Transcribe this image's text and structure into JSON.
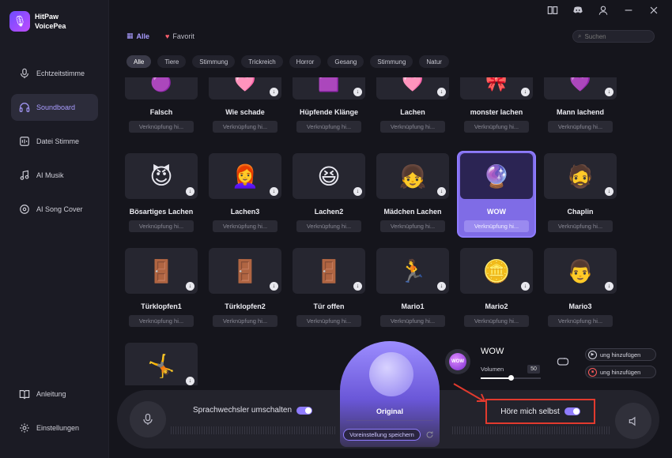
{
  "app": {
    "name_line1": "HitPaw",
    "name_line2": "VoicePea"
  },
  "sidebar": {
    "items": [
      {
        "label": "Echtzeitstimme",
        "icon": "microphone-icon"
      },
      {
        "label": "Soundboard",
        "icon": "headphones-icon",
        "active": true
      },
      {
        "label": "Datei Stimme",
        "icon": "file-voice-icon"
      },
      {
        "label": "AI Musik",
        "icon": "music-note-icon"
      },
      {
        "label": "AI Song Cover",
        "icon": "disc-icon"
      }
    ],
    "bottom": [
      {
        "label": "Anleitung",
        "icon": "book-icon"
      },
      {
        "label": "Einstellungen",
        "icon": "gear-icon"
      }
    ]
  },
  "tabs": [
    {
      "label": "Alle",
      "icon": "grid-icon",
      "active": true
    },
    {
      "label": "Favorit",
      "icon": "heart-icon"
    }
  ],
  "search": {
    "placeholder": "Suchen"
  },
  "filters": [
    "Alle",
    "Tiere",
    "Stimmung",
    "Trickreich",
    "Horror",
    "Gesang",
    "Stimmung",
    "Natur"
  ],
  "shortcut_label": "Verknüpfung hi...",
  "sounds_row1": [
    "Falsch",
    "Wie schade",
    "Hüpfende Klänge",
    "Lachen",
    "monster lachen",
    "Mann lachend"
  ],
  "sounds_row2": [
    "Bösartiges Lachen",
    "Lachen3",
    "Lachen2",
    "Mädchen Lachen",
    "WOW",
    "Chaplin"
  ],
  "sounds_row3": [
    "Türklopfen1",
    "Türklopfen2",
    "Tür offen",
    "Mario1",
    "Mario2",
    "Mario3"
  ],
  "bottom_panel": {
    "voice_switch_label": "Sprachwechsler umschalten",
    "original_label": "Original",
    "preset_button": "Voreinstellung speichern",
    "now_playing": "WOW",
    "now_playing_badge": "WOW",
    "volume_label": "Volumen",
    "volume_value": "50",
    "volume_fraction": 0.5,
    "add_play_label": "ung hinzufügen",
    "add_record_label": "ung hinzufügen",
    "hear_myself_label": "Höre mich selbst"
  },
  "colors": {
    "accent": "#8f7cff",
    "highlight_box": "#e23a2e"
  }
}
